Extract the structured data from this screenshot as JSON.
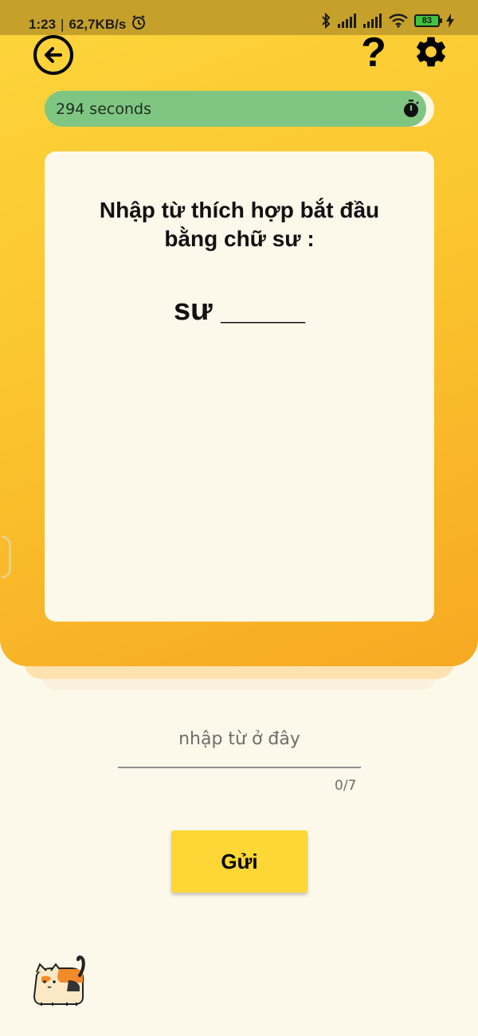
{
  "status_bar": {
    "time": "1:23",
    "network_speed": "62,7KB/s",
    "battery_level": "83",
    "icons": [
      "alarm-icon",
      "bluetooth-icon",
      "signal-icon",
      "signal-icon",
      "wifi-icon",
      "battery-icon",
      "charging-icon"
    ]
  },
  "header": {
    "back_icon": "arrow-left-icon",
    "help_label": "?",
    "settings_icon": "gear-icon"
  },
  "timer": {
    "label": "294 seconds",
    "remaining_fraction": 0.98,
    "fill_color": "#7fc683"
  },
  "question": {
    "prompt": "Nhập từ thích hợp bắt đầu bằng chữ sư :",
    "target": "sư _____"
  },
  "answer": {
    "placeholder": "nhập từ ở đây",
    "value": "",
    "counter": "0/7"
  },
  "submit": {
    "label": "Gửi"
  },
  "colors": {
    "accent": "#fcd736",
    "panel_top": "#fdd53c",
    "panel_bottom": "#f6a922",
    "background": "#fcf8ea"
  }
}
